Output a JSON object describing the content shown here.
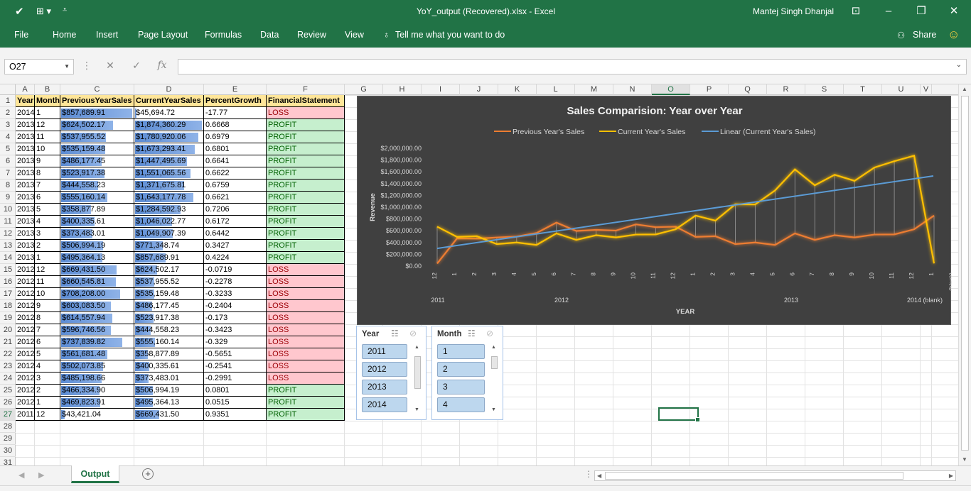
{
  "window": {
    "title": "YoY_output (Recovered).xlsx  -  Excel",
    "user": "Mantej Singh Dhanjal"
  },
  "ribbon": {
    "tabs": [
      "File",
      "Home",
      "Insert",
      "Page Layout",
      "Formulas",
      "Data",
      "Review",
      "View"
    ],
    "tell_me": "Tell me what you want to do",
    "share": "Share"
  },
  "formula_bar": {
    "name_box": "O27",
    "value": ""
  },
  "columns": [
    "A",
    "B",
    "C",
    "D",
    "E",
    "F",
    "G",
    "H",
    "I",
    "J",
    "K",
    "L",
    "M",
    "N",
    "O",
    "P",
    "Q",
    "R",
    "S",
    "T",
    "U",
    "V"
  ],
  "selected_cell": "O27",
  "rows": [
    "1",
    "2",
    "3",
    "4",
    "5",
    "6",
    "7",
    "8",
    "9",
    "10",
    "11",
    "12",
    "13",
    "14",
    "15",
    "16",
    "17",
    "18",
    "19",
    "20",
    "21",
    "22",
    "23",
    "24",
    "25",
    "26",
    "27",
    "28",
    "29",
    "30",
    "31"
  ],
  "table": {
    "headers": [
      "Year",
      "Month",
      "PreviousYearSales",
      "CurrentYearSales",
      "PercentGrowth",
      "FinancialStatement"
    ],
    "rows": [
      [
        "2014",
        "1",
        "$857,689.91",
        "$45,694.72",
        "-17.77",
        "LOSS"
      ],
      [
        "2013",
        "12",
        "$624,502.17",
        "$1,874,360.29",
        "0.6668",
        "PROFIT"
      ],
      [
        "2013",
        "11",
        "$537,955.52",
        "$1,780,920.06",
        "0.6979",
        "PROFIT"
      ],
      [
        "2013",
        "10",
        "$535,159.48",
        "$1,673,293.41",
        "0.6801",
        "PROFIT"
      ],
      [
        "2013",
        "9",
        "$486,177.45",
        "$1,447,495.69",
        "0.6641",
        "PROFIT"
      ],
      [
        "2013",
        "8",
        "$523,917.38",
        "$1,551,065.56",
        "0.6622",
        "PROFIT"
      ],
      [
        "2013",
        "7",
        "$444,558.23",
        "$1,371,675.81",
        "0.6759",
        "PROFIT"
      ],
      [
        "2013",
        "6",
        "$555,160.14",
        "$1,643,177.78",
        "0.6621",
        "PROFIT"
      ],
      [
        "2013",
        "5",
        "$358,877.89",
        "$1,284,592.93",
        "0.7206",
        "PROFIT"
      ],
      [
        "2013",
        "4",
        "$400,335.61",
        "$1,046,022.77",
        "0.6172",
        "PROFIT"
      ],
      [
        "2013",
        "3",
        "$373,483.01",
        "$1,049,907.39",
        "0.6442",
        "PROFIT"
      ],
      [
        "2013",
        "2",
        "$506,994.19",
        "$771,348.74",
        "0.3427",
        "PROFIT"
      ],
      [
        "2013",
        "1",
        "$495,364.13",
        "$857,689.91",
        "0.4224",
        "PROFIT"
      ],
      [
        "2012",
        "12",
        "$669,431.50",
        "$624,502.17",
        "-0.0719",
        "LOSS"
      ],
      [
        "2012",
        "11",
        "$660,545.81",
        "$537,955.52",
        "-0.2278",
        "LOSS"
      ],
      [
        "2012",
        "10",
        "$708,208.00",
        "$535,159.48",
        "-0.3233",
        "LOSS"
      ],
      [
        "2012",
        "9",
        "$603,083.50",
        "$486,177.45",
        "-0.2404",
        "LOSS"
      ],
      [
        "2012",
        "8",
        "$614,557.94",
        "$523,917.38",
        "-0.173",
        "LOSS"
      ],
      [
        "2012",
        "7",
        "$596,746.56",
        "$444,558.23",
        "-0.3423",
        "LOSS"
      ],
      [
        "2012",
        "6",
        "$737,839.82",
        "$555,160.14",
        "-0.329",
        "LOSS"
      ],
      [
        "2012",
        "5",
        "$561,681.48",
        "$358,877.89",
        "-0.5651",
        "LOSS"
      ],
      [
        "2012",
        "4",
        "$502,073.85",
        "$400,335.61",
        "-0.2541",
        "LOSS"
      ],
      [
        "2012",
        "3",
        "$485,198.66",
        "$373,483.01",
        "-0.2991",
        "LOSS"
      ],
      [
        "2012",
        "2",
        "$466,334.90",
        "$506,994.19",
        "0.0801",
        "PROFIT"
      ],
      [
        "2012",
        "1",
        "$469,823.91",
        "$495,364.13",
        "0.0515",
        "PROFIT"
      ],
      [
        "2011",
        "12",
        "$43,421.04",
        "$669,431.50",
        "0.9351",
        "PROFIT"
      ]
    ]
  },
  "chart_data": {
    "type": "line",
    "title": "Sales Comparision: Year over Year",
    "xlabel": "YEAR",
    "ylabel": "Revenue",
    "legend": [
      "Previous Year's Sales",
      "Current Year's Sales",
      "Linear (Current Year's Sales)"
    ],
    "legend_position": "top",
    "ylim": [
      0,
      2000000
    ],
    "yticks": [
      "$0.00",
      "$200,000.00",
      "$400,000.00",
      "$600,000.00",
      "$800,000.00",
      "$1,000,000.00",
      "$1,200,000.00",
      "$1,400,000.00",
      "$1,600,000.00",
      "$1,800,000.00",
      "$2,000,000.00"
    ],
    "x_month_labels": [
      "12",
      "1",
      "2",
      "3",
      "4",
      "5",
      "6",
      "7",
      "8",
      "9",
      "10",
      "11",
      "12",
      "1",
      "2",
      "3",
      "4",
      "5",
      "6",
      "7",
      "8",
      "9",
      "10",
      "11",
      "12",
      "1",
      "(blank)"
    ],
    "x_year_labels": [
      "2011",
      "2012",
      "2013",
      "2014 (blank)"
    ],
    "series": [
      {
        "name": "Previous Year's Sales",
        "color": "#ed7d31",
        "values": [
          43421.04,
          469823.91,
          466334.9,
          485198.66,
          502073.85,
          561681.48,
          737839.82,
          596746.56,
          614557.94,
          603083.5,
          708208.0,
          660545.81,
          669431.5,
          495364.13,
          506994.19,
          373483.01,
          400335.61,
          358877.89,
          555160.14,
          444558.23,
          523917.38,
          486177.45,
          535159.48,
          537955.52,
          624502.17,
          857689.91
        ]
      },
      {
        "name": "Current Year's Sales",
        "color": "#ffc000",
        "values": [
          669431.5,
          495364.13,
          506994.19,
          373483.01,
          400335.61,
          358877.89,
          555160.14,
          444558.23,
          523917.38,
          486177.45,
          535159.48,
          537955.52,
          624502.17,
          857689.91,
          771348.74,
          1049907.39,
          1046022.77,
          1284592.93,
          1643177.78,
          1371675.81,
          1551065.56,
          1447495.69,
          1673293.41,
          1780920.06,
          1874360.29,
          45694.72
        ]
      },
      {
        "name": "Linear (Current Year's Sales)",
        "color": "#5b9bd5",
        "trend": [
          300000,
          1530000
        ]
      }
    ],
    "colors": {
      "background": "#404040",
      "text": "#d9d9d9"
    }
  },
  "slicers": [
    {
      "title": "Year",
      "items": [
        "2011",
        "2012",
        "2013",
        "2014"
      ]
    },
    {
      "title": "Month",
      "items": [
        "1",
        "2",
        "3",
        "4"
      ]
    }
  ],
  "sheet_tabs": {
    "active": "Output"
  }
}
